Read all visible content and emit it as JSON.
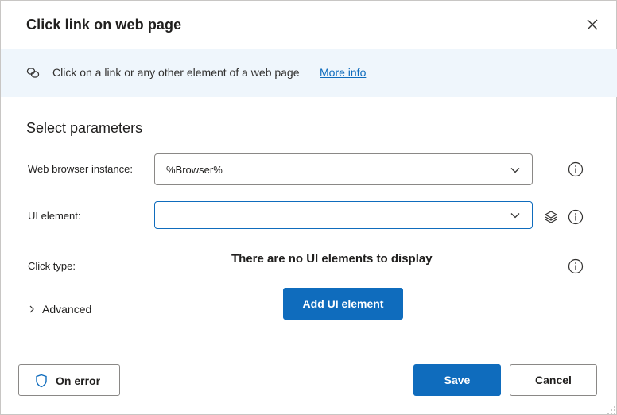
{
  "dialog": {
    "title": "Click link on web page",
    "close_icon": "close-icon"
  },
  "banner": {
    "icon": "link-icon",
    "text": "Click on a link or any other element of a web page",
    "link_text": "More info"
  },
  "parameters": {
    "section_title": "Select parameters",
    "browser_instance": {
      "label": "Web browser instance:",
      "value": "%Browser%"
    },
    "ui_element": {
      "label": "UI element:",
      "value": ""
    },
    "click_type": {
      "label": "Click type:"
    },
    "empty_message": "There are no UI elements to display",
    "add_ui_element_label": "Add UI element",
    "advanced_label": "Advanced"
  },
  "footer": {
    "on_error_label": "On error",
    "save_label": "Save",
    "cancel_label": "Cancel"
  },
  "colors": {
    "accent": "#0f6cbd",
    "banner_bg": "#eff6fc",
    "border": "#8a8886"
  }
}
